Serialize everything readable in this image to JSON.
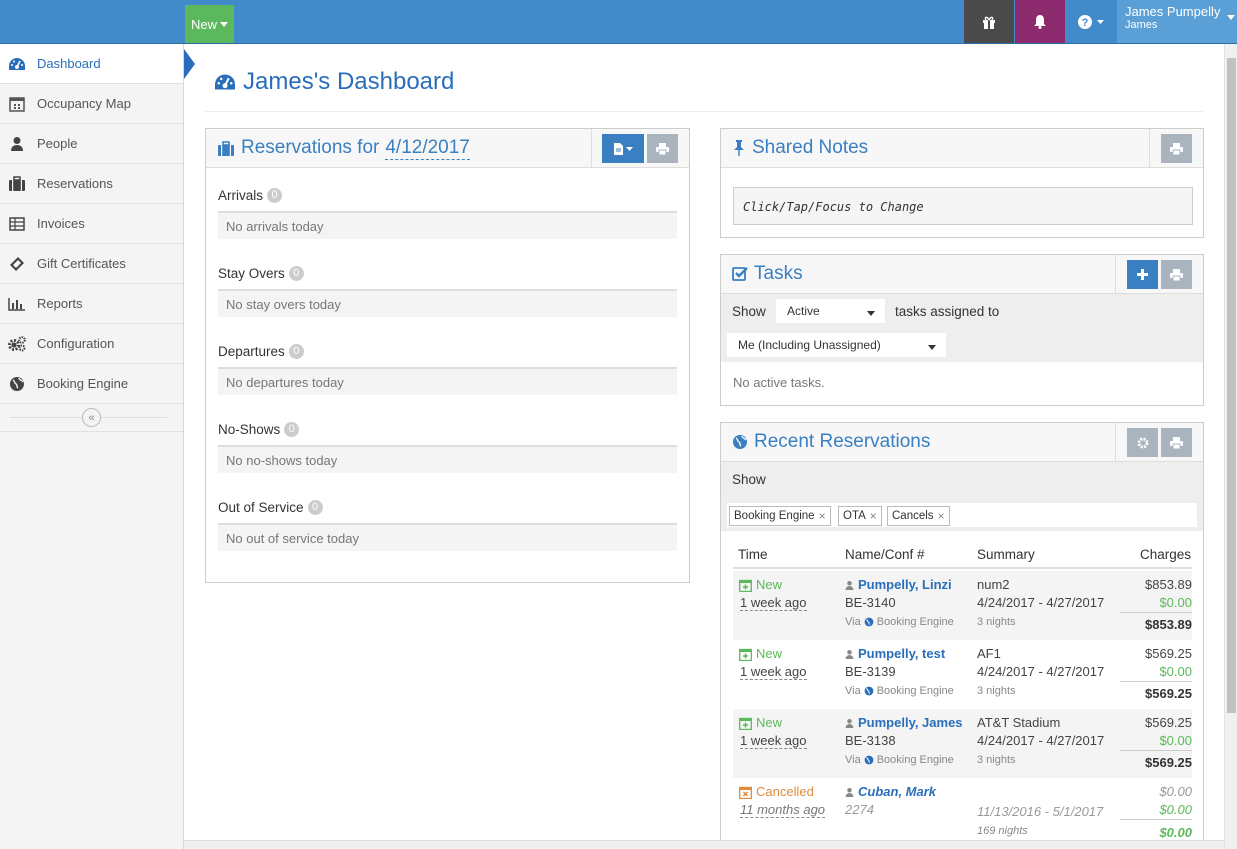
{
  "topbar": {
    "new_label": "New",
    "user_name": "James Pumpelly",
    "user_short": "James",
    "icons": [
      "gift-icon",
      "bell-icon",
      "help-icon"
    ]
  },
  "sidebar": {
    "items": [
      {
        "label": "Dashboard",
        "icon": "dashboard-icon"
      },
      {
        "label": "Occupancy Map",
        "icon": "calendar-icon"
      },
      {
        "label": "People",
        "icon": "user-icon"
      },
      {
        "label": "Reservations",
        "icon": "briefcase-icon"
      },
      {
        "label": "Invoices",
        "icon": "table-icon"
      },
      {
        "label": "Gift Certificates",
        "icon": "ticket-icon"
      },
      {
        "label": "Reports",
        "icon": "bar-chart-icon"
      },
      {
        "label": "Configuration",
        "icon": "gears-icon"
      },
      {
        "label": "Booking Engine",
        "icon": "globe-icon"
      }
    ],
    "collapse_glyph": "«"
  },
  "page": {
    "title": "James's Dashboard"
  },
  "reservations": {
    "title_prefix": "Reservations for",
    "date": "4/12/2017",
    "sections": [
      {
        "name": "Arrivals",
        "count": "0",
        "empty": "No arrivals today"
      },
      {
        "name": "Stay Overs",
        "count": "0",
        "empty": "No stay overs today"
      },
      {
        "name": "Departures",
        "count": "0",
        "empty": "No departures today"
      },
      {
        "name": "No-Shows",
        "count": "0",
        "empty": "No no-shows today"
      },
      {
        "name": "Out of Service",
        "count": "0",
        "empty": "No out of service today"
      }
    ]
  },
  "notes": {
    "title": "Shared Notes",
    "placeholder": "Click/Tap/Focus to Change"
  },
  "tasks": {
    "title": "Tasks",
    "show_label": "Show",
    "status_value": "Active",
    "assigned_label": "tasks assigned to",
    "assignee_value": "Me (Including Unassigned)",
    "empty": "No active tasks."
  },
  "recent": {
    "title": "Recent Reservations",
    "show_label": "Show",
    "filters": [
      "Booking Engine",
      "OTA",
      "Cancels"
    ],
    "columns": {
      "time": "Time",
      "name": "Name/Conf #",
      "summary": "Summary",
      "charges": "Charges"
    },
    "rows": [
      {
        "status": "New",
        "ago": "1 week ago",
        "name": "Pumpelly, Linzi",
        "conf": "BE-3140",
        "via": "Via",
        "source": "Booking Engine",
        "summary": "num2",
        "dates": "4/24/2017 - 4/27/2017",
        "nights": "3 nights",
        "charge": "$853.89",
        "paid": "$0.00",
        "total": "$853.89"
      },
      {
        "status": "New",
        "ago": "1 week ago",
        "name": "Pumpelly, test",
        "conf": "BE-3139",
        "via": "Via",
        "source": "Booking Engine",
        "summary": "AF1",
        "dates": "4/24/2017 - 4/27/2017",
        "nights": "3 nights",
        "charge": "$569.25",
        "paid": "$0.00",
        "total": "$569.25"
      },
      {
        "status": "New",
        "ago": "1 week ago",
        "name": "Pumpelly, James",
        "conf": "BE-3138",
        "via": "Via",
        "source": "Booking Engine",
        "summary": "AT&T Stadium",
        "dates": "4/24/2017 - 4/27/2017",
        "nights": "3 nights",
        "charge": "$569.25",
        "paid": "$0.00",
        "total": "$569.25"
      },
      {
        "status": "Cancelled",
        "ago": "11 months ago",
        "name": "Cuban, Mark",
        "conf": "2274",
        "summary": "",
        "dates": "11/13/2016 - 5/1/2017",
        "nights": "169 nights",
        "charge": "$0.00",
        "paid": "$0.00",
        "total": "$0.00"
      }
    ]
  },
  "colors": {
    "topbar": "#428bca",
    "accent": "#2a6ebb",
    "new_button": "#5cb85c",
    "bell": "#8b2a6c",
    "cancelled": "#e08a3a"
  }
}
